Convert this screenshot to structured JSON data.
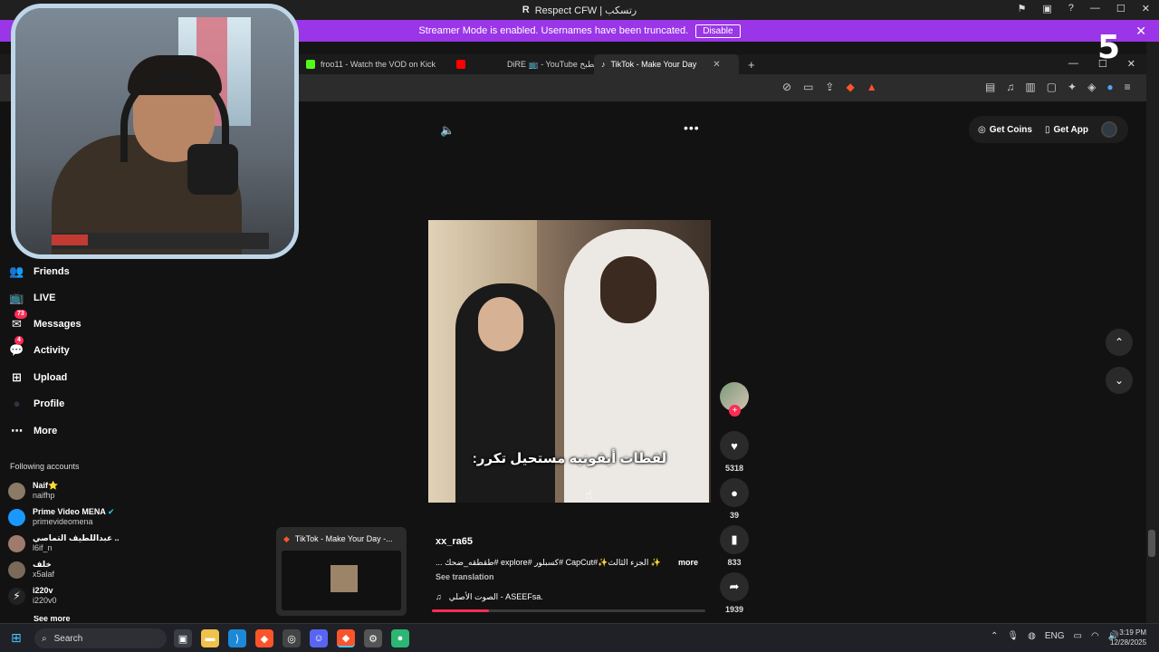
{
  "window": {
    "title": "Respect CFW | رتسكب"
  },
  "banner": {
    "text": "Streamer Mode is enabled. Usernames have been truncated.",
    "button": "Disable"
  },
  "tabs": [
    {
      "label": "froo11 - Watch the VOD on Kick",
      "color": "#53fc18"
    },
    {
      "label": "DiRE 📺 - YouTube مطبخ",
      "color": "#ff0000"
    },
    {
      "label": "TikTok - Make Your Day",
      "color": "#ffffff"
    }
  ],
  "sidebar": {
    "items": [
      {
        "label": "Friends",
        "icon": "friends-icon",
        "glyph": "👥"
      },
      {
        "label": "LIVE",
        "icon": "live-icon",
        "glyph": "📺"
      },
      {
        "label": "Messages",
        "icon": "messages-icon",
        "glyph": "✉",
        "badge": "73"
      },
      {
        "label": "Activity",
        "icon": "activity-icon",
        "glyph": "💬",
        "badge": "4"
      },
      {
        "label": "Upload",
        "icon": "upload-icon",
        "glyph": "⊞"
      },
      {
        "label": "Profile",
        "icon": "profile-icon",
        "glyph": "●"
      },
      {
        "label": "More",
        "icon": "more-icon",
        "glyph": "⋯"
      }
    ],
    "following_title": "Following accounts",
    "accounts": [
      {
        "name": "Naif⭐",
        "handle": "naifhp",
        "color": "#8b7a66"
      },
      {
        "name": "Prime Video MENA",
        "handle": "primevideomena",
        "color": "#1a98ff"
      },
      {
        "name": "عبداللطيف التماصي ..",
        "handle": "l6if_n",
        "color": "#a07a6a"
      },
      {
        "name": "خلف",
        "handle": "x5alaf",
        "color": "#7a6a5a"
      },
      {
        "name": "i220v",
        "handle": "i220v0",
        "color": "#222"
      },
      {
        "name": "See more",
        "handle": "",
        "color": ""
      }
    ]
  },
  "topbar": {
    "get_coins": "Get Coins",
    "get_app": "Get App"
  },
  "video": {
    "caption": "لقطات أيقونيه مستحيل تكرر:",
    "author": "xx_ra65",
    "description": "✨ الجزء الثالث✨#CapCut #كسبلور #explore #طقطقه_ضحك ...",
    "more": "more",
    "see_translation": "See translation",
    "music": "الصوت الأصلي - ASEEFsa.",
    "progress": 0.21
  },
  "actions": {
    "likes": "5318",
    "comments": "39",
    "saves": "833",
    "shares": "1939"
  },
  "preview": {
    "title": "TikTok - Make Your Day -..."
  },
  "overlay_logo": "5",
  "taskbar": {
    "search": "Search",
    "lang": "ENG",
    "time": "3:19 PM",
    "date": "12/28/2025"
  }
}
